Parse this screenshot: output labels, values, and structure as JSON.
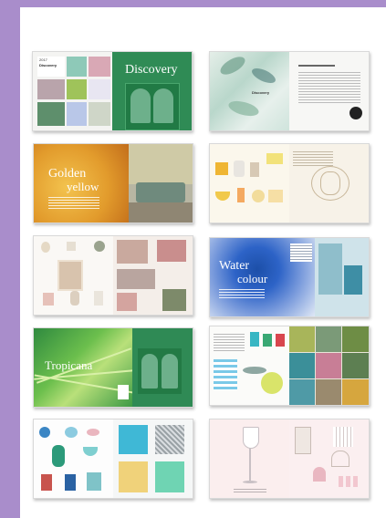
{
  "brand_colors": {
    "accent": "#a98dcb"
  },
  "spreads": [
    {
      "id": "discovery",
      "title": "Discovery",
      "edition": "2017",
      "brand_text": "Discovery"
    },
    {
      "id": "discovery-intro",
      "brand_text": "Discovery"
    },
    {
      "id": "golden-yellow",
      "title_line1": "Golden",
      "title_line2": "yellow"
    },
    {
      "id": "yellow-products"
    },
    {
      "id": "neutral-decor"
    },
    {
      "id": "water-colour",
      "title_line1": "Water",
      "title_line2": "colour"
    },
    {
      "id": "tropicana",
      "title": "Tropicana"
    },
    {
      "id": "turquoise-decor"
    },
    {
      "id": "blue-accessories"
    },
    {
      "id": "pink-glass"
    }
  ]
}
